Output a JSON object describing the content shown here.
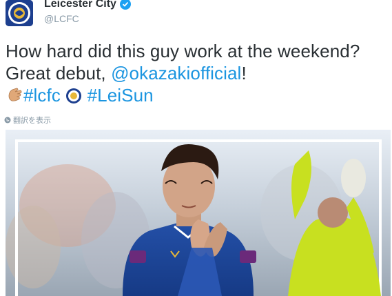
{
  "tweet": {
    "display_name": "Leicester City",
    "handle": "@LCFC",
    "text_part1": "How hard did this guy work at the weekend? Great debut, ",
    "mention": "@okazakiofficial",
    "text_part2": "!",
    "hashtag1": "#lcfc",
    "hashtag2": "#LeiSun",
    "translate_label": "翻訳を表示",
    "icons": [
      "verified-badge-icon",
      "clap-emoji-icon",
      "lcfc-crest-emoji-icon",
      "globe-icon"
    ]
  },
  "colors": {
    "link": "#1b95e0",
    "text": "#292f33",
    "muted": "#8899a6",
    "verified": "#1da1f2",
    "club_blue": "#1d3f8f"
  }
}
